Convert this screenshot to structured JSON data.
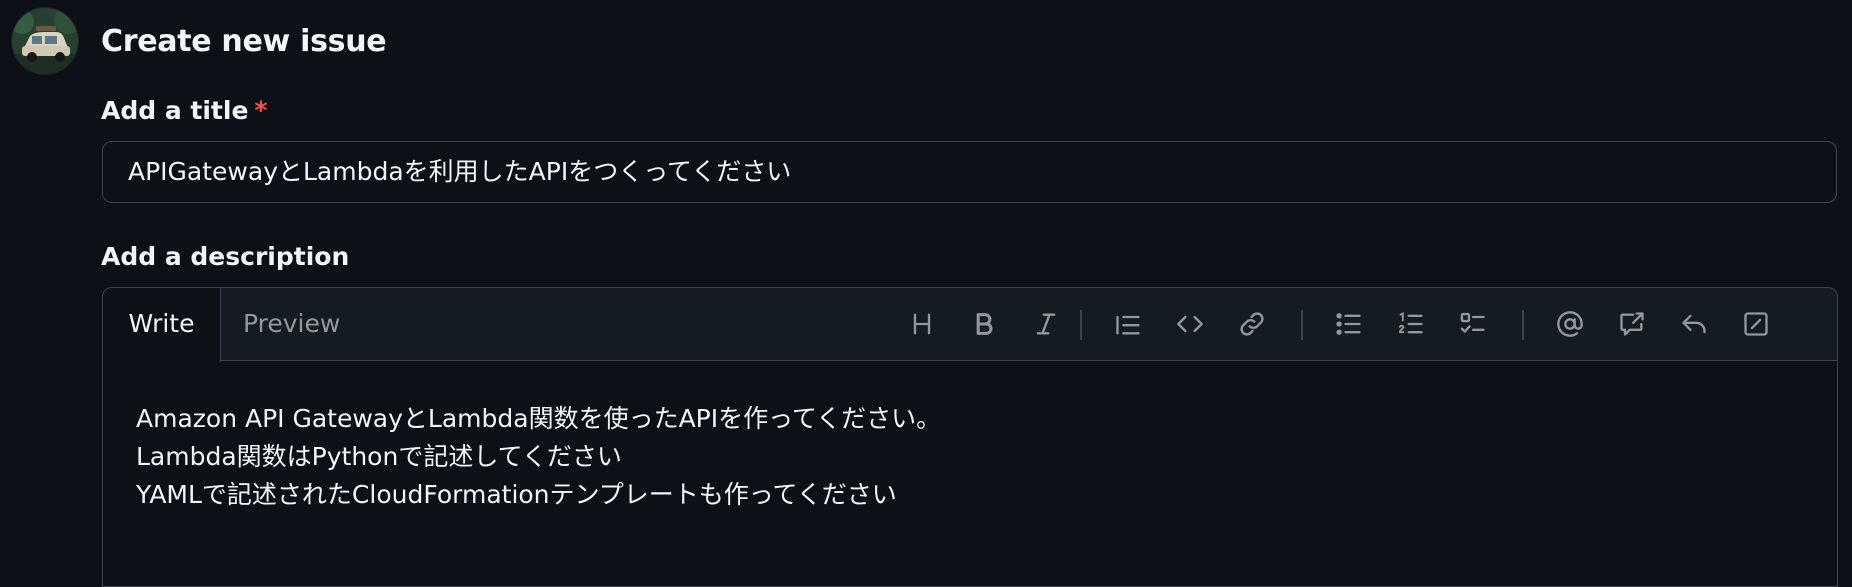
{
  "page": {
    "title": "Create new issue"
  },
  "title_field": {
    "label": "Add a title",
    "required_mark": "*",
    "value": "APIGatewayとLambdaを利用したAPIをつくってください"
  },
  "description": {
    "label": "Add a description",
    "tabs": {
      "write": "Write",
      "preview": "Preview"
    },
    "toolbar_icons": [
      "heading-icon",
      "bold-icon",
      "italic-icon",
      "quote-icon",
      "code-icon",
      "link-icon",
      "unordered-list-icon",
      "ordered-list-icon",
      "task-list-icon",
      "mention-icon",
      "reference-icon",
      "saved-replies-icon",
      "slash-commands-icon"
    ],
    "body_lines": [
      "Amazon API GatewayとLambda関数を使ったAPIを作ってください。",
      "Lambda関数はPythonで記述してください",
      "YAMLで記述されたCloudFormationテンプレートも作ってください"
    ]
  },
  "colors": {
    "background": "#0d1117",
    "border": "#3d444d",
    "required": "#f85149",
    "muted": "#9198a1"
  }
}
